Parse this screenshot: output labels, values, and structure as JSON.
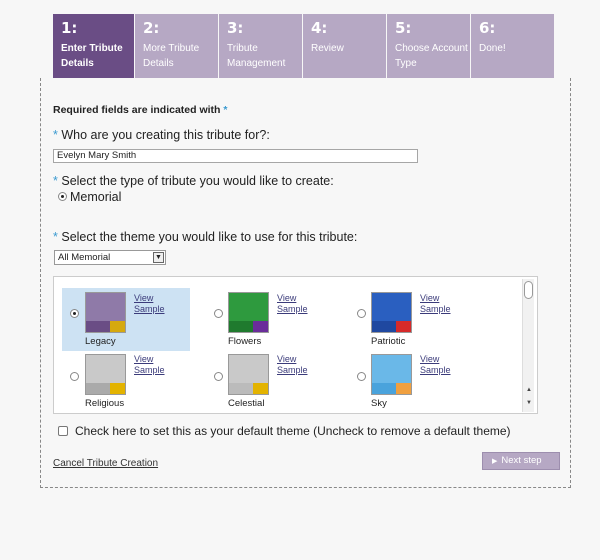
{
  "steps": [
    {
      "num": "1:",
      "label": "Enter Tribute Details"
    },
    {
      "num": "2:",
      "label": "More Tribute Details"
    },
    {
      "num": "3:",
      "label": "Tribute Management"
    },
    {
      "num": "4:",
      "label": "Review"
    },
    {
      "num": "5:",
      "label": "Choose Account Type"
    },
    {
      "num": "6:",
      "label": "Done!"
    }
  ],
  "required_note": "Required fields are indicated with",
  "required_star": "*",
  "q1": {
    "star": "*",
    "label": "Who are you creating this tribute for?:",
    "value": "Evelyn Mary Smith"
  },
  "q2": {
    "star": "*",
    "label": "Select the type of tribute you would like to create:",
    "option": "Memorial",
    "selected": true
  },
  "q3": {
    "star": "*",
    "label": "Select the theme you would like to use for this tribute:",
    "select_value": "All Memorial"
  },
  "view_label": "View",
  "sample_label": "Sample",
  "themes": [
    {
      "name": "Legacy",
      "selected": true,
      "colors": [
        "#8f7aa8",
        "#6a4d85",
        "#d6a90f"
      ]
    },
    {
      "name": "Flowers",
      "selected": false,
      "colors": [
        "#2e9a3e",
        "#1f7a2e",
        "#6a2d9a"
      ]
    },
    {
      "name": "Patriotic",
      "selected": false,
      "colors": [
        "#2a5fc0",
        "#1f48a0",
        "#d62a2a"
      ]
    },
    {
      "name": "Religious",
      "selected": false,
      "colors": [
        "#c9c9c9",
        "#aaaaaa",
        "#e3b300"
      ]
    },
    {
      "name": "Celestial",
      "selected": false,
      "colors": [
        "#c9c9c9",
        "#bbbbbb",
        "#e3b300"
      ]
    },
    {
      "name": "Sky",
      "selected": false,
      "colors": [
        "#6ab8e8",
        "#4aa3dc",
        "#f0a040"
      ]
    }
  ],
  "default_theme_label": "Check here to set this as your default theme (Uncheck to remove a default theme)",
  "cancel_label": "Cancel Tribute Creation",
  "next_label": "Next step"
}
